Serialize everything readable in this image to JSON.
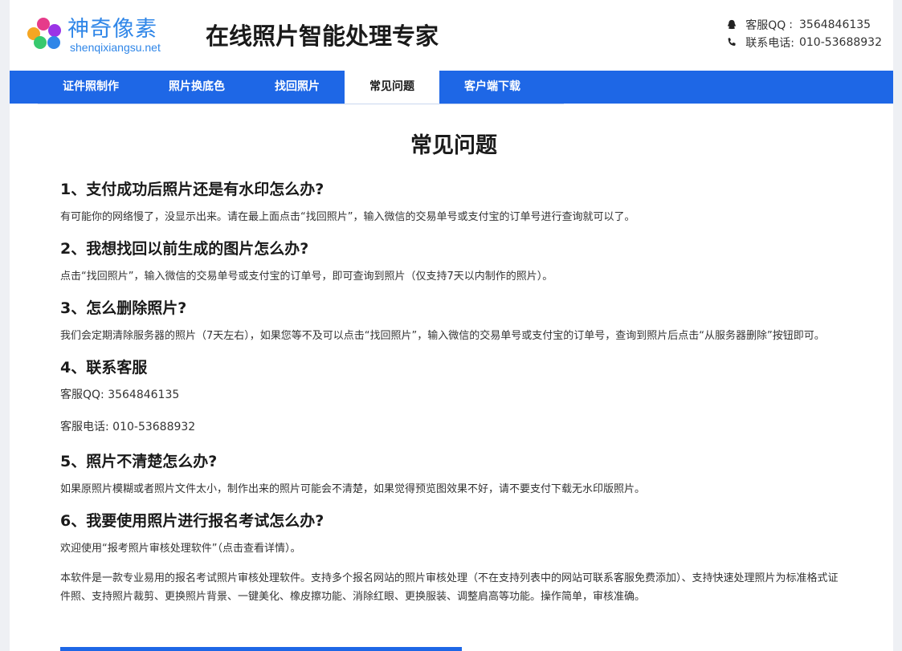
{
  "brand": {
    "name_cn": "神奇像素",
    "domain": "shenqixiangsu.net",
    "dot_colors": [
      "#f5a623",
      "#e63b8a",
      "#9b34e6",
      "#37c96e",
      "#2f86e8"
    ]
  },
  "header": {
    "title": "在线照片智能处理专家",
    "qq_label": "客服QQ",
    "qq_sep": ":",
    "qq_value": "3564846135",
    "phone_label": "联系电话:",
    "phone_value": "010-53688932"
  },
  "nav": {
    "items": [
      "证件照制作",
      "照片换底色",
      "找回照片",
      "常见问题",
      "客户端下载"
    ],
    "active_index": 3
  },
  "main": {
    "heading": "常见问题",
    "faqs": [
      {
        "q": "1、支付成功后照片还是有水印怎么办?",
        "a": "有可能你的网络慢了，没显示出来。请在最上面点击“找回照片”，输入微信的交易单号或支付宝的订单号进行查询就可以了。"
      },
      {
        "q": "2、我想找回以前生成的图片怎么办?",
        "a": "点击“找回照片”，输入微信的交易单号或支付宝的订单号，即可查询到照片（仅支持7天以内制作的照片）。"
      },
      {
        "q": "3、怎么删除照片?",
        "a": "我们会定期清除服务器的照片（7天左右），如果您等不及可以点击“找回照片”，输入微信的交易单号或支付宝的订单号，查询到照片后点击“从服务器删除”按钮即可。"
      },
      {
        "q": "4、联系客服",
        "a1": "客服QQ: 3564846135",
        "a2": "客服电话: 010-53688932"
      },
      {
        "q": "5、照片不清楚怎么办?",
        "a": "如果原照片模糊或者照片文件太小，制作出来的照片可能会不清楚，如果觉得预览图效果不好，请不要支付下载无水印版照片。"
      },
      {
        "q": "6、我要使用照片进行报名考试怎么办?",
        "a": "欢迎使用“报考照片审核处理软件”（点击查看详情）。",
        "a2": "本软件是一款专业易用的报名考试照片审核处理软件。支持多个报名网站的照片审核处理（不在支持列表中的网站可联系客服免费添加）、支持快速处理照片为标准格式证件照、支持照片裁剪、更换照片背景、一键美化、橡皮擦功能、消除红眼、更换服装、调整肩高等功能。操作简单，审核准确。"
      }
    ]
  }
}
